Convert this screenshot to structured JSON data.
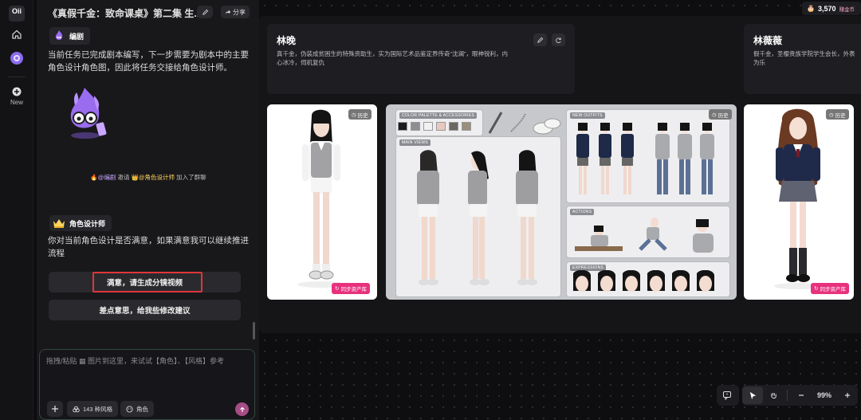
{
  "rail": {
    "logo": "Oii",
    "new_label": "New"
  },
  "chat": {
    "title": "《真假千金：致命课桌》第二集 生...",
    "share_label": "分享",
    "writer_role": "编剧",
    "writer_message": "当前任务已完成剧本编写，下一步需要为剧本中的主要角色设计角色图，因此将任务交接给角色设计师。",
    "join_writer": "@编剧",
    "join_invite": "邀请",
    "join_designer": "@角色设计师",
    "join_suffix": "加入了群聊",
    "designer_role": "角色设计师",
    "designer_message": "你对当前角色设计是否满意，如果满意我可以继续推进流程",
    "option_accept": "满意，请生成分镜视频",
    "option_revise": "差点意思，给我些修改建议",
    "input_placeholder": "拖拽/粘贴 ▦ 图片到这里，来试试【角色】、【风格】参考",
    "style_chip": "143 种风格",
    "role_chip": "角色"
  },
  "header": {
    "coins": "3,570",
    "coins_tag": "赚金币"
  },
  "characters": [
    {
      "name": "林晚",
      "description_line1": "真千金，伪装成贫困生的特殊资助生，实为国际艺术品鉴定界传奇“沈澜”，眼神锐利，内",
      "description_line2": "心冰冷，伺机复仇"
    },
    {
      "name": "林薇薇",
      "description_line1": "假千金，圣樱贵族学院学生会长，外表",
      "description_line2": "为乐"
    }
  ],
  "image_cards": {
    "history_label": "历史",
    "sync_label": "同步资产库"
  },
  "sheet": {
    "palette_label": "COLOR PALETTE & ACCESSORIES",
    "main_views_label": "MAIN VIEWS",
    "new_outfits_label": "NEW OUTFITS",
    "actions_label": "ACTIONS",
    "expressions_label": "EXPRESSIONS",
    "swatch_colors": [
      "#1c1c1e",
      "#8e8e92",
      "#f2f2f2",
      "#e8c9c0",
      "#6a6660",
      "#9b8e7e"
    ]
  },
  "toolbar": {
    "zoom": "99%"
  },
  "colors": {
    "accent_pink": "#e8317d",
    "highlight_red": "#e0353b",
    "writer_purple": "#9a6cf0",
    "designer_gold": "#ffd35c"
  }
}
